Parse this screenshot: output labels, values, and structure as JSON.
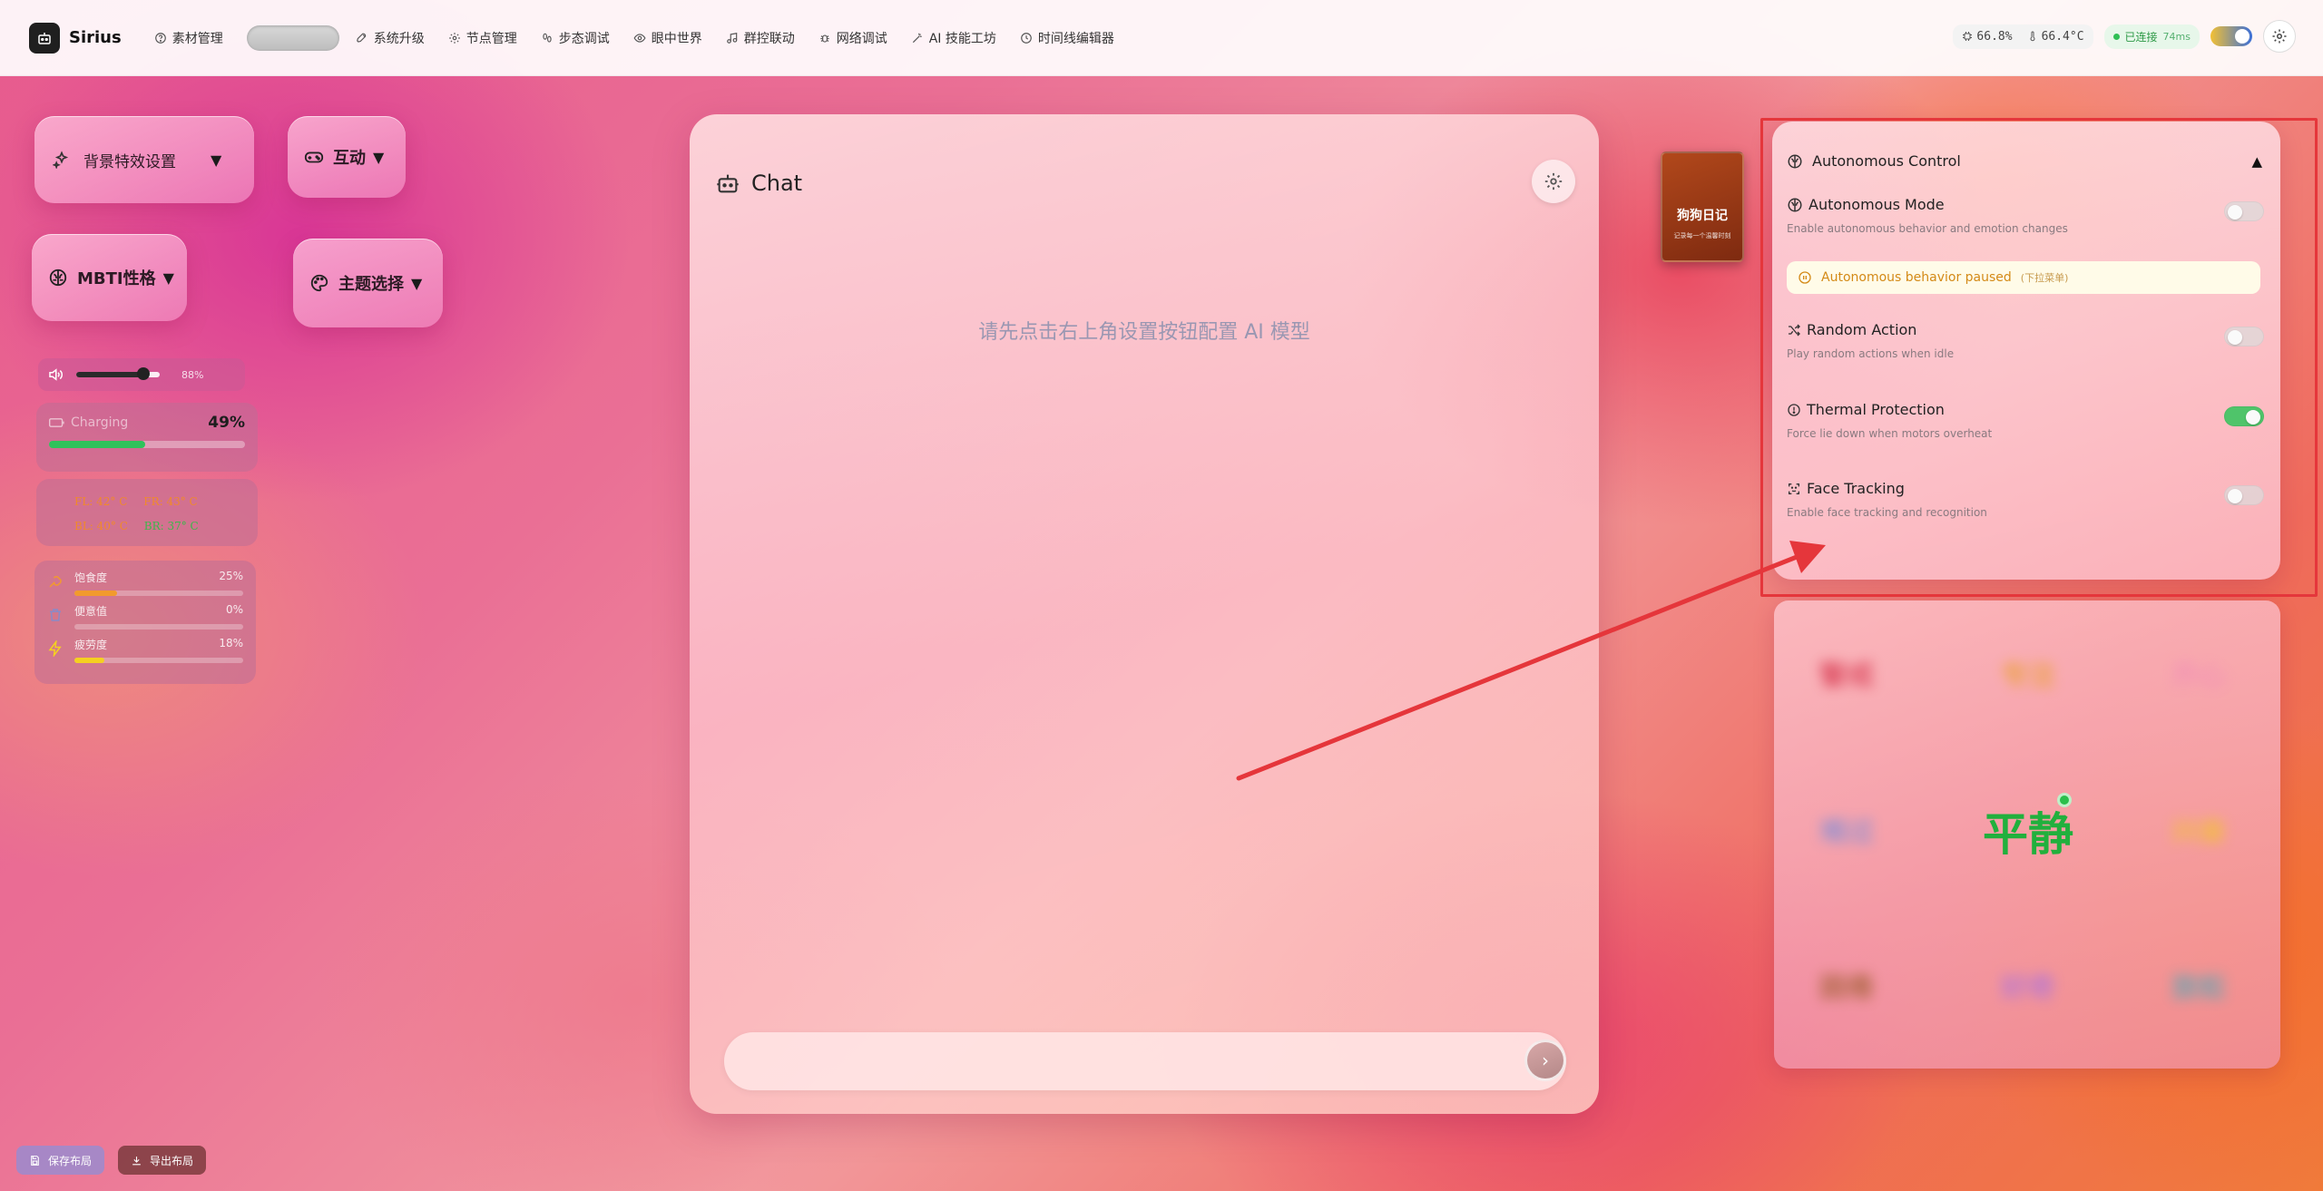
{
  "app": {
    "name": "Sirius"
  },
  "nav": {
    "items": [
      {
        "label": "素材管理",
        "icon": "help-circle-icon"
      },
      {
        "label": "系统升级",
        "icon": "rocket-icon"
      },
      {
        "label": "节点管理",
        "icon": "gear-icon"
      },
      {
        "label": "步态调试",
        "icon": "footprints-icon"
      },
      {
        "label": "眼中世界",
        "icon": "eye-icon"
      },
      {
        "label": "群控联动",
        "icon": "music-icon"
      },
      {
        "label": "网络调试",
        "icon": "bug-icon"
      },
      {
        "label": "AI 技能工坊",
        "icon": "magic-wand-icon"
      },
      {
        "label": "时间线编辑器",
        "icon": "clock-icon"
      }
    ]
  },
  "status": {
    "cpu": "66.8%",
    "temp": "66.4°C",
    "connection": "已连接",
    "latency": "74ms"
  },
  "left": {
    "bg_effects": "背景特效设置",
    "interact": "互动",
    "mbti": "MBTI性格",
    "theme": "主题选择",
    "volume": {
      "value": 0.8,
      "label": "88%"
    },
    "battery": {
      "label": "Charging",
      "percent_label": "49%",
      "value": 0.49
    },
    "temps": {
      "fl": "FL: 42° C",
      "fr": "FR: 43° C",
      "bl": "BL: 40° C",
      "br": "BR: 37° C"
    },
    "needs": [
      {
        "label": "饱食度",
        "value_label": "25%",
        "value": 0.25,
        "color": "#f29a2e",
        "icon": "food-icon"
      },
      {
        "label": "便意值",
        "value_label": "0%",
        "value": 0,
        "color": "#8a8ac8",
        "icon": "trash-icon"
      },
      {
        "label": "疲劳度",
        "value_label": "18%",
        "value": 0.18,
        "color": "#f5d020",
        "icon": "lightning-icon"
      }
    ]
  },
  "chat": {
    "title": "Chat",
    "hint": "请先点击右上角设置按钮配置 AI 模型",
    "input_placeholder": ""
  },
  "diary": {
    "title": "狗狗日记",
    "subtitle": "记录每一个温馨时刻"
  },
  "autonomous": {
    "title": "Autonomous Control",
    "mode": {
      "title": "Autonomous Mode",
      "desc": "Enable autonomous behavior and emotion changes",
      "on": false
    },
    "paused": {
      "text": "Autonomous behavior paused",
      "sub": "(下拉菜单)"
    },
    "random": {
      "title": "Random Action",
      "desc": "Play random actions when idle",
      "on": false
    },
    "thermal": {
      "title": "Thermal Protection",
      "desc": "Force lie down when motors overheat",
      "on": true
    },
    "face": {
      "title": "Face Tracking",
      "desc": "Enable face tracking and recognition",
      "on": false
    }
  },
  "emotions": {
    "top_left": "警戒",
    "top_mid": "专注",
    "top_right": "开心",
    "mid_left": "难过",
    "center": "平静",
    "mid_right": "兴奋",
    "bot_left": "困倦",
    "bot_mid": "好奇",
    "bot_right": "放松",
    "colors": {
      "top_left": "#d7384f",
      "top_mid": "#e8a12a",
      "top_right": "#f08ab8",
      "mid_left": "#7a8cd8",
      "mid_right": "#f2c52a",
      "bot_left": "#9a5a2a",
      "bot_mid": "#a870e0",
      "bot_right": "#4aa8b8"
    }
  },
  "footer": {
    "save": "保存布局",
    "export": "导出布局"
  },
  "colors": {
    "accent_green": "#2fc25b",
    "annotation_red": "#e5363b"
  }
}
